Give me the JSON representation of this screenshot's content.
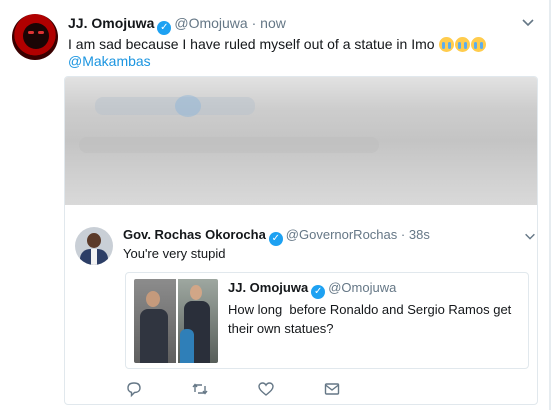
{
  "tweet": {
    "author_name": "JJ. Omojuwa",
    "author_handle": "@Omojuwa",
    "separator": "·",
    "time": "now",
    "text": "I am sad because I have ruled myself out of a statue in Imo",
    "mention": "@Makambas",
    "emoji_count": 3
  },
  "quoted": {
    "author_name": "Gov. Rochas Okorocha",
    "author_handle": "@GovernorRochas",
    "separator": "·",
    "time": "38s",
    "text": "You're very stupid"
  },
  "inner_quoted": {
    "author_name": "JJ. Omojuwa",
    "author_handle": "@Omojuwa",
    "text": "How long  before Ronaldo and Sergio Ramos get their own statues?"
  },
  "icons": {
    "main_menu": "chevron-down-icon",
    "quote_menu": "chevron-down-icon",
    "reply": "reply-icon",
    "retweet": "retweet-icon",
    "like": "heart-icon",
    "dm": "envelope-icon",
    "verified": "verified-badge-icon"
  },
  "colors": {
    "link": "#1b95e0",
    "verified": "#1da1f2",
    "muted": "#657786",
    "text": "#14171a",
    "border": "#e1e8ed"
  }
}
